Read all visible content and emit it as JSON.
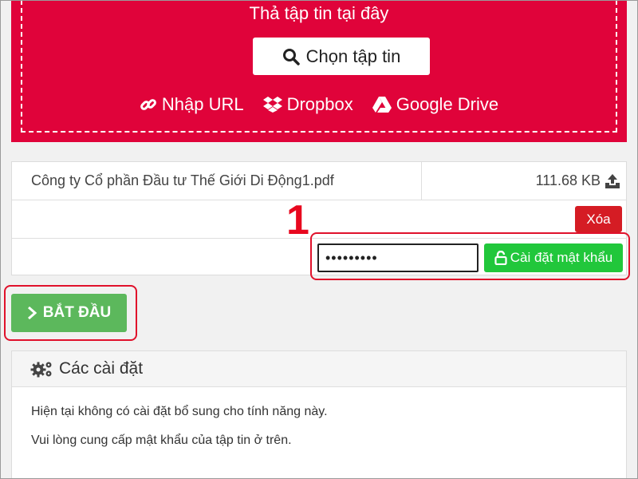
{
  "dropzone": {
    "title": "Thả tập tin tại đây",
    "choose_label": "Chọn tập tin",
    "sources": [
      {
        "label": "Nhập URL",
        "icon": "link-icon"
      },
      {
        "label": "Dropbox",
        "icon": "dropbox-icon"
      },
      {
        "label": "Google Drive",
        "icon": "google-drive-icon"
      }
    ]
  },
  "file": {
    "name": "Công ty Cổ phần Đầu tư Thế Giới Di Động1.pdf",
    "size": "111.68 KB",
    "delete_label": "Xóa",
    "password_value": "•••••••••",
    "set_password_label": "Cài đặt mật khẩu"
  },
  "annotation": {
    "number": "1"
  },
  "start_label": "BẮT ĐẦU",
  "settings": {
    "title": "Các cài đặt",
    "lines": [
      "Hiện tại không có cài đặt bổ sung cho tính năng này.",
      "Vui lòng cung cấp mật khẩu của tập tin ở trên."
    ]
  },
  "colors": {
    "dropzone_bg": "#e0033a",
    "delete_bg": "#d51c24",
    "set_password_bg": "#21c73b",
    "start_bg": "#5cb85c",
    "annotation": "#e0112b"
  }
}
